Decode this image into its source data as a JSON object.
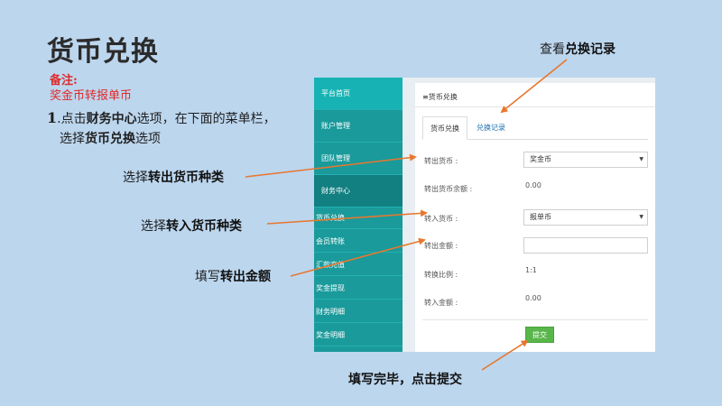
{
  "slide": {
    "title": "货币兑换",
    "note_label": "备注:",
    "note_text": "奖金币转报单币",
    "step_num": "1",
    "step_a": ".点击",
    "step_b": "财务中心",
    "step_c": "选项，在下面的菜单栏，",
    "step_d": "选择",
    "step_e": "货币兑换",
    "step_f": "选项",
    "callout_top_a": "查看",
    "callout_top_b": "兑换记录",
    "callout1_a": "选择",
    "callout1_b": "转出货币种类",
    "callout2_a": "选择",
    "callout2_b": "转入货币种类",
    "callout3_a": "填写",
    "callout3_b": "转出金额",
    "callout_bottom": "填写完毕，点击提交"
  },
  "colors": {
    "background": "#bcd6ee",
    "sidebar": "#1a9a9b",
    "arrow": "#e8772e",
    "note": "#e02a2a",
    "submit": "#59b64a"
  },
  "sidebar": {
    "items": [
      {
        "label": "平台首页"
      },
      {
        "label": "账户管理"
      },
      {
        "label": "团队管理"
      },
      {
        "label": "财务中心"
      }
    ],
    "subitems": [
      {
        "label": "货币兑换"
      },
      {
        "label": "会员转账"
      },
      {
        "label": "汇款充值"
      },
      {
        "label": "奖金提现"
      },
      {
        "label": "财务明细"
      },
      {
        "label": "奖金明细"
      }
    ]
  },
  "panel": {
    "title_icon": "≡",
    "title": "货币兑换",
    "tabs": [
      {
        "label": "货币兑换"
      },
      {
        "label": "兑换记录"
      }
    ],
    "fields": {
      "out_currency_label": "转出货币 :",
      "out_currency_value": "奖金币",
      "out_balance_label": "转出货币余额 :",
      "out_balance_value": "0.00",
      "in_currency_label": "转入货币 :",
      "in_currency_value": "报单币",
      "out_amount_label": "转出金额 :",
      "out_amount_value": "",
      "ratio_label": "转换比例 :",
      "ratio_value": "1:1",
      "in_amount_label": "转入金额 :",
      "in_amount_value": "0.00"
    },
    "submit_label": "提交"
  }
}
